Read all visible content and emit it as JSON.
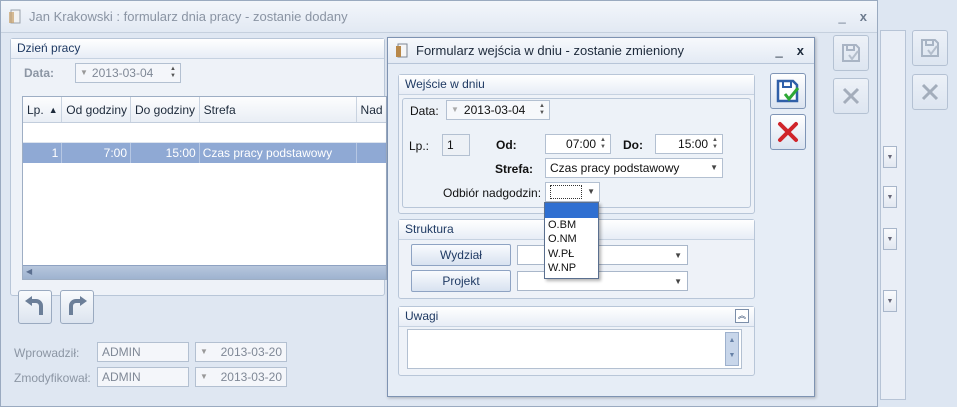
{
  "main_window": {
    "title": "Jan Krakowski : formularz dnia pracy - zostanie dodany",
    "minimize": "_",
    "close": "x",
    "group_title": "Dzień pracy",
    "date_label": "Data:",
    "date_value": "2013-03-04",
    "grid": {
      "columns": [
        "Lp.",
        "Od godziny",
        "Do godziny",
        "Strefa",
        "Nad"
      ],
      "sort_indicator": "▲",
      "rows": [
        {
          "lp": "1",
          "od": "7:00",
          "do": "15:00",
          "strefa": "Czas pracy podstawowy",
          "nad": ""
        }
      ]
    },
    "footer": {
      "entered_label": "Wprowadził:",
      "entered_user": "ADMIN",
      "entered_date": "2013-03-20",
      "modified_label": "Zmodyfikował:",
      "modified_user": "ADMIN",
      "modified_date": "2013-03-20"
    }
  },
  "dialog": {
    "title": "Formularz wejścia w dniu - zostanie zmieniony",
    "minimize": "_",
    "close": "x",
    "group_entry": "Wejście w dniu",
    "date_label": "Data:",
    "date_value": "2013-03-04",
    "lp_label": "Lp.:",
    "lp_value": "1",
    "from_label": "Od:",
    "from_value": "07:00",
    "to_label": "Do:",
    "to_value": "15:00",
    "zone_label": "Strefa:",
    "zone_value": "Czas pracy podstawowy",
    "overtime_label": "Odbiór nadgodzin:",
    "overtime_value": "",
    "overtime_options": [
      "",
      "O.BM",
      "O.NM",
      "W.PŁ",
      "W.NP"
    ],
    "group_structure": "Struktura",
    "department_button": "Wydział",
    "department_value": "",
    "project_button": "Projekt",
    "project_value": "",
    "group_notes": "Uwagi",
    "notes_value": ""
  },
  "icons": {
    "save": "save-icon",
    "cancel": "cancel-icon",
    "undo": "rotate-left-icon",
    "redo": "rotate-right-icon"
  },
  "colors": {
    "selection": "#2f6fd1",
    "row_highlight": "#8fa9d4",
    "cancel_red": "#d0242a",
    "save_blue": "#2f5fa8",
    "save_check": "#2ea836"
  }
}
